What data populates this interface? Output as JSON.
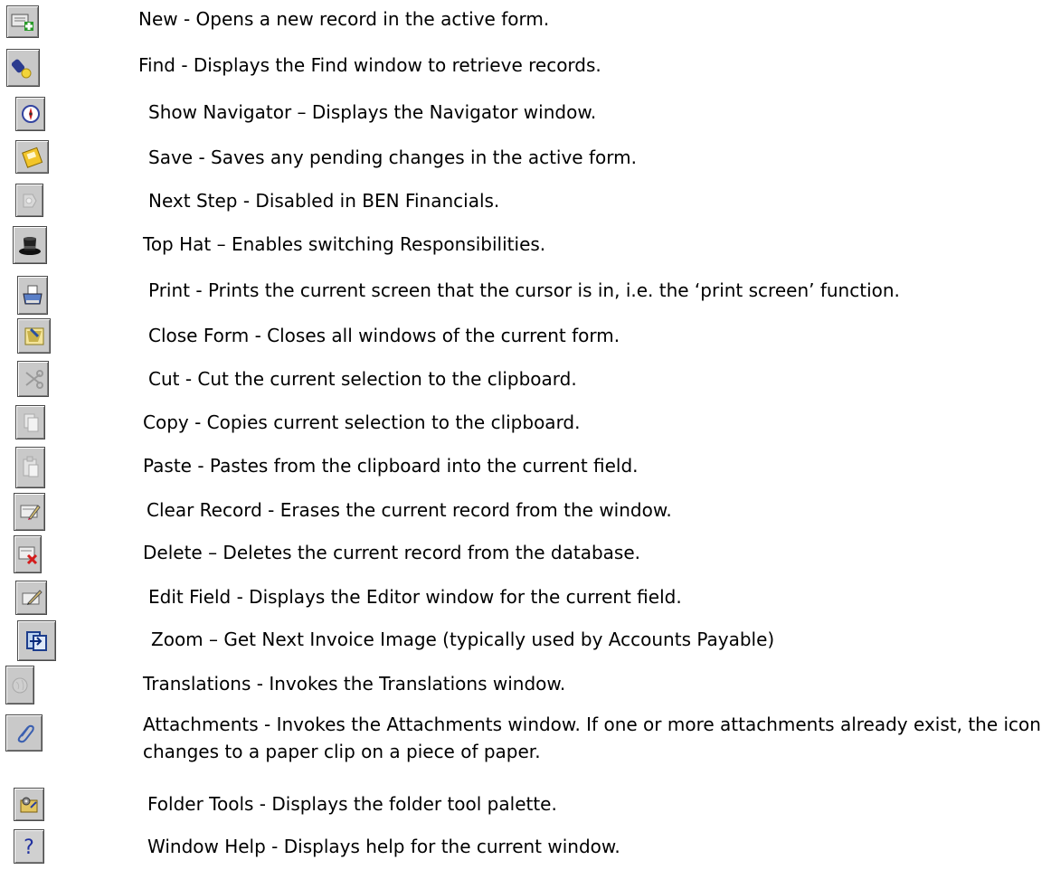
{
  "toolbar_reference": {
    "items": [
      {
        "icon": "new-record-icon",
        "text": "New - Opens a new record in the active form."
      },
      {
        "icon": "find-flashlight-icon",
        "text": "Find - Displays the Find window to retrieve records."
      },
      {
        "icon": "navigator-compass-icon",
        "text": "Show Navigator – Displays the Navigator window."
      },
      {
        "icon": "save-disk-icon",
        "text": "Save - Saves any pending changes in the active form."
      },
      {
        "icon": "next-step-icon",
        "text": "Next Step - Disabled in BEN Financials."
      },
      {
        "icon": "top-hat-icon",
        "text": "Top Hat – Enables switching Responsibilities."
      },
      {
        "icon": "print-icon",
        "text": "Print - Prints the current screen that the cursor is in, i.e. the ‘print screen’ function."
      },
      {
        "icon": "close-form-icon",
        "text": "Close Form - Closes all windows of the current form."
      },
      {
        "icon": "cut-scissors-icon",
        "text": "Cut - Cut the current selection to the clipboard."
      },
      {
        "icon": "copy-icon",
        "text": "Copy - Copies current selection to the clipboard."
      },
      {
        "icon": "paste-icon",
        "text": "Paste - Pastes from the clipboard into the current field."
      },
      {
        "icon": "clear-record-icon",
        "text": "Clear Record - Erases the current record from the window."
      },
      {
        "icon": "delete-record-icon",
        "text": "Delete – Deletes the current record from the database."
      },
      {
        "icon": "edit-field-icon",
        "text": "Edit Field - Displays the Editor window for the current field."
      },
      {
        "icon": "zoom-icon",
        "text": "Zoom – Get Next Invoice Image (typically used by Accounts Payable)"
      },
      {
        "icon": "translations-globe-icon",
        "text": "Translations - Invokes the Translations window."
      },
      {
        "icon": "attachments-paperclip-icon",
        "text": "Attachments - Invokes the Attachments window. If one or more attachments already exist, the icon changes to a paper clip on a piece of paper."
      },
      {
        "icon": "folder-tools-icon",
        "text": "Folder Tools - Displays the folder tool palette."
      },
      {
        "icon": "window-help-icon",
        "text": "Window Help - Displays help for the current window."
      }
    ]
  }
}
